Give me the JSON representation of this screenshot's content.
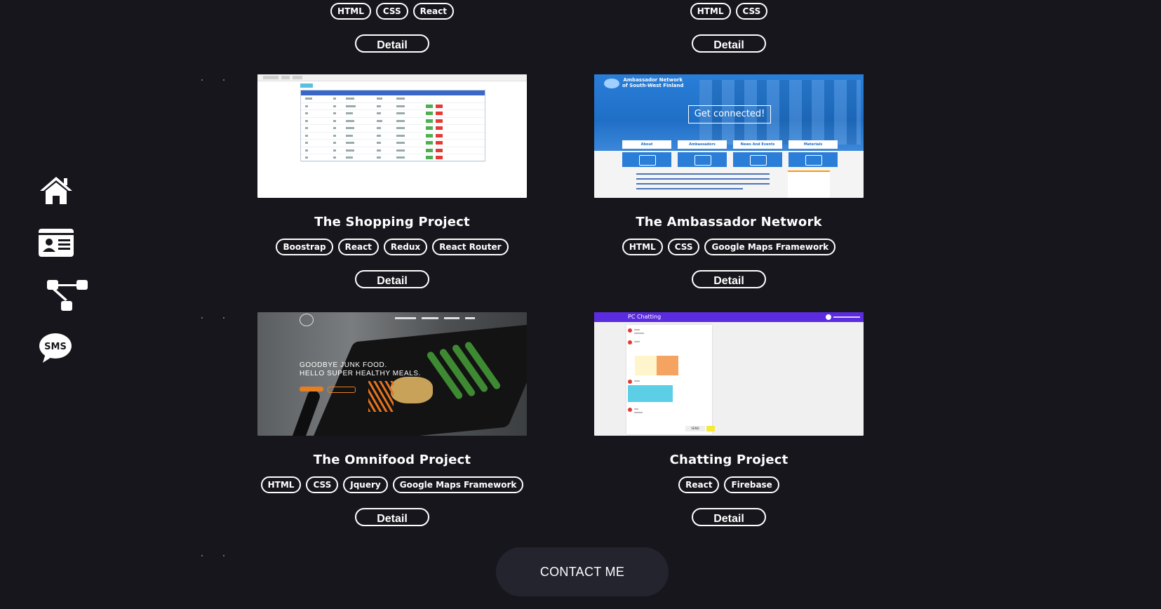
{
  "nav": {
    "items": [
      {
        "icon": "home-icon"
      },
      {
        "icon": "id-card-icon"
      },
      {
        "icon": "sitemap-icon"
      },
      {
        "icon": "sms-icon",
        "label": "SMS"
      }
    ]
  },
  "top_projects": [
    {
      "tags": [
        "HTML",
        "CSS",
        "React"
      ],
      "detail_label": "Detail"
    },
    {
      "tags": [
        "HTML",
        "CSS"
      ],
      "detail_label": "Detail"
    }
  ],
  "projects": [
    {
      "title": "The Shopping Project",
      "tags": [
        "Boostrap",
        "React",
        "Redux",
        "React Router"
      ],
      "detail_label": "Detail"
    },
    {
      "title": "The Ambassador Network",
      "tags": [
        "HTML",
        "CSS",
        "Google Maps Framework"
      ],
      "detail_label": "Detail"
    },
    {
      "title": "The Omnifood Project",
      "tags": [
        "HTML",
        "CSS",
        "Jquery",
        "Google Maps Framework"
      ],
      "detail_label": "Detail"
    },
    {
      "title": "Chatting Project",
      "tags": [
        "React",
        "Firebase"
      ],
      "detail_label": "Detail"
    }
  ],
  "thumbnails": {
    "ambassador": {
      "brand_line1": "Ambassador Network",
      "brand_line2": "of South-West Finland",
      "cta": "Get connected!",
      "nav": [
        "About",
        "Ambassadors",
        "News And Events",
        "Materials"
      ]
    },
    "omnifood": {
      "headline_line1": "GOODBYE JUNK FOOD.",
      "headline_line2": "HELLO SUPER HEALTHY MEALS."
    },
    "chat": {
      "app_title": "PC Chatting",
      "send": "SEND"
    }
  },
  "contact": {
    "label": "CONTACT ME"
  },
  "colors": {
    "background": "#16161c",
    "contact_bg": "#24242e",
    "text": "#ffffff"
  }
}
